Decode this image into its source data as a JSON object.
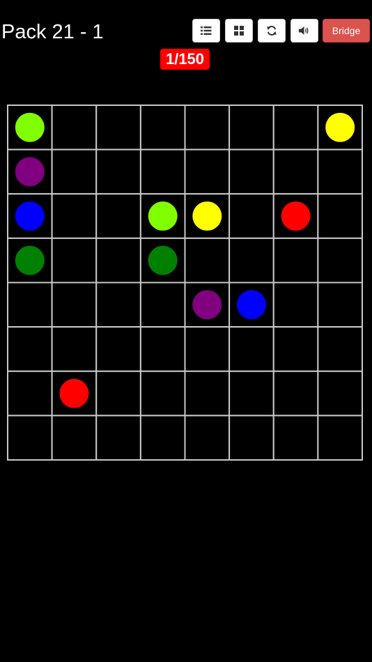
{
  "header": {
    "title": "Pack 21 - 1",
    "counter": "1/150"
  },
  "toolbar": {
    "list_icon": "list-icon",
    "grid_icon": "grid-icon",
    "reset_icon": "refresh-icon",
    "sound_icon": "volume-icon",
    "bridge_label": "Bridge"
  },
  "board": {
    "rows": 8,
    "cols": 8,
    "grid_color": "#c8c8c8",
    "dots": [
      {
        "row": 0,
        "col": 0,
        "color": "#7fff00"
      },
      {
        "row": 0,
        "col": 7,
        "color": "#ffff00"
      },
      {
        "row": 1,
        "col": 0,
        "color": "#800080"
      },
      {
        "row": 2,
        "col": 0,
        "color": "#0000ff"
      },
      {
        "row": 2,
        "col": 3,
        "color": "#7fff00"
      },
      {
        "row": 2,
        "col": 4,
        "color": "#ffff00"
      },
      {
        "row": 2,
        "col": 6,
        "color": "#ff0000"
      },
      {
        "row": 3,
        "col": 0,
        "color": "#008000"
      },
      {
        "row": 3,
        "col": 3,
        "color": "#008000"
      },
      {
        "row": 4,
        "col": 4,
        "color": "#800080"
      },
      {
        "row": 4,
        "col": 5,
        "color": "#0000ff"
      },
      {
        "row": 6,
        "col": 1,
        "color": "#ff0000"
      }
    ]
  }
}
